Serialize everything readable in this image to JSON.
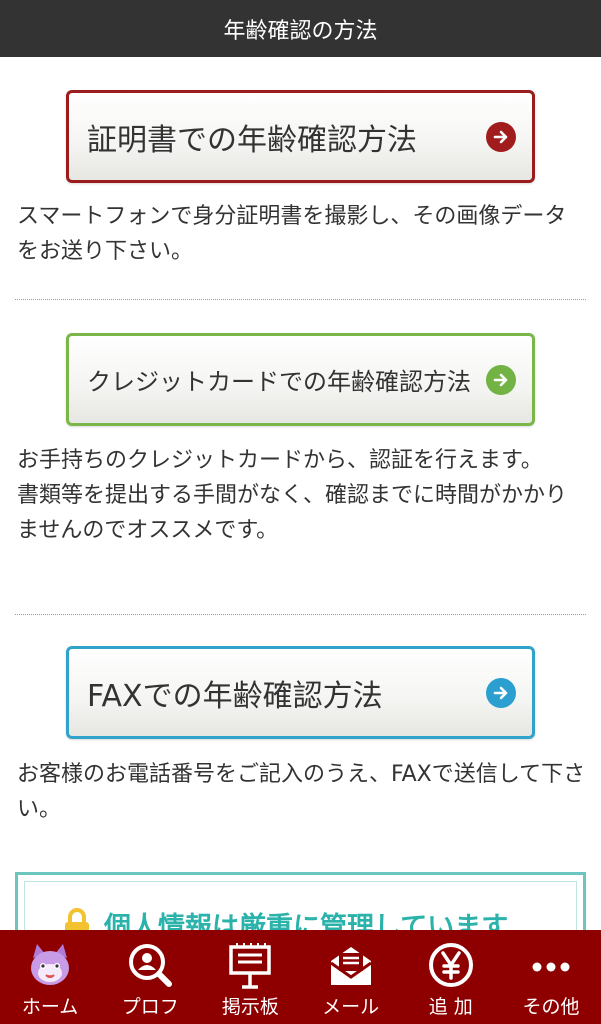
{
  "header": {
    "title": "年齢確認の方法"
  },
  "methods": [
    {
      "button_label": "証明書での年齢確認方法",
      "description": "スマートフォンで身分証明書を撮影し、その画像データをお送り下さい。",
      "color": "#9b1c1c"
    },
    {
      "button_label": "クレジットカードでの年齢確認方法",
      "description_line1": "お手持ちのクレジットカードから、認証を行えます。",
      "description_line2": "書類等を提出する手間がなく、確認までに時間がかかりませんのでオススメです。",
      "color": "#7ab648"
    },
    {
      "button_label": "FAXでの年齢確認方法",
      "description": "お客様のお電話番号をご記入のうえ、FAXで送信して下さい。",
      "color": "#2fa3c9"
    }
  ],
  "privacy": {
    "title": "個人情報は厳重に管理しています"
  },
  "tabbar": {
    "color": "#8e0000",
    "items": [
      {
        "label": "ホーム",
        "icon": "cat-mascot-icon"
      },
      {
        "label": "プロフ",
        "icon": "profile-search-icon"
      },
      {
        "label": "掲示板",
        "icon": "bulletin-board-icon"
      },
      {
        "label": "メール",
        "icon": "mail-icon"
      },
      {
        "label": "追 加",
        "icon": "yen-icon"
      },
      {
        "label": "その他",
        "icon": "more-dots-icon"
      }
    ]
  }
}
